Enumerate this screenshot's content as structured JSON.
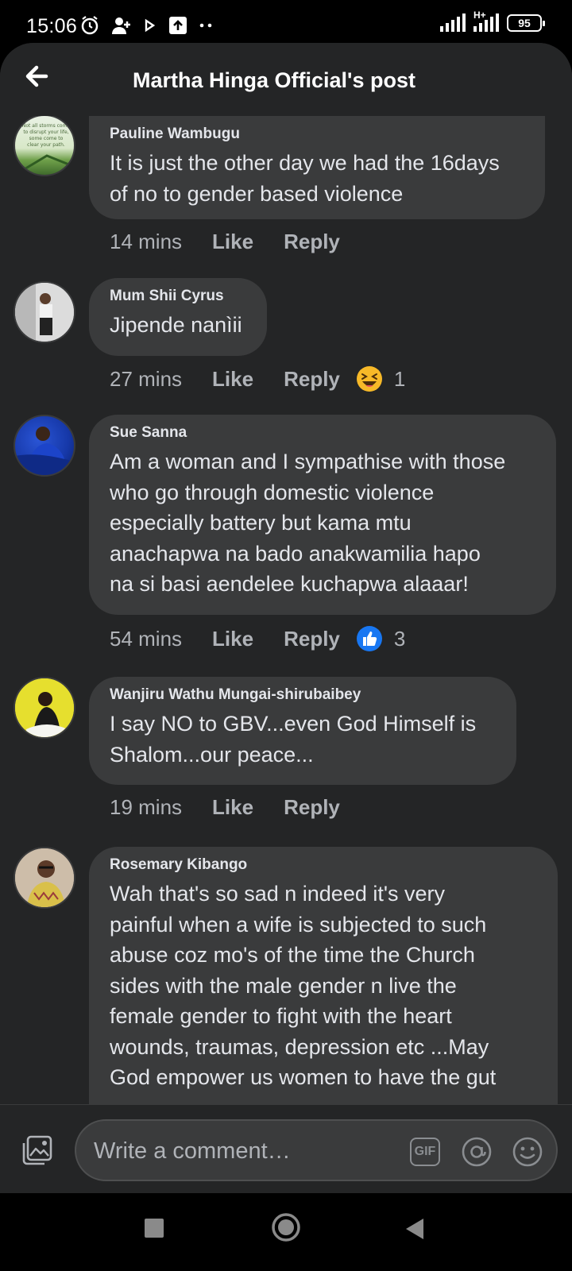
{
  "status_bar": {
    "time": "15:06",
    "network_label": "H+",
    "battery": "95"
  },
  "header": {
    "title": "Martha Hinga Official's post"
  },
  "comments": [
    {
      "author": "Pauline Wambugu",
      "lines": [
        "It is just the other day we had the 16days",
        "of no to gender based violence"
      ],
      "time": "14 mins",
      "like": "Like",
      "reply": "Reply",
      "reaction_count": null
    },
    {
      "author": "Mum Shii Cyrus",
      "lines": [
        "Jipende nanìii"
      ],
      "time": "27 mins",
      "like": "Like",
      "reply": "Reply",
      "reaction_count": "1",
      "reaction": "laughing-emoji"
    },
    {
      "author": "Sue Sanna",
      "lines": [
        "Am a woman and I sympathise with those",
        "who go through domestic violence",
        "especially battery but kama mtu",
        "anachapwa na bado anakwamilia hapo",
        "na si basi aendelee kuchapwa alaaar!"
      ],
      "time": "54 mins",
      "like": "Like",
      "reply": "Reply",
      "reaction_count": "3",
      "reaction": "like-thumb"
    },
    {
      "author": "Wanjiru Wathu Mungai-shirubaibey",
      "lines": [
        "I say NO to GBV...even God Himself is",
        "Shalom...our peace..."
      ],
      "time": "19 mins",
      "like": "Like",
      "reply": "Reply",
      "reaction_count": null
    },
    {
      "author": "Rosemary Kibango",
      "lines": [
        "Wah that's so sad n indeed it's very",
        "painful when a wife is subjected to such",
        "abuse coz mo's of the time the Church",
        "sides with the male gender n live the",
        "female gender to fight with the heart",
        "wounds, traumas, depression etc ...May",
        "God empower us women to have the gut"
      ],
      "time": "",
      "like": "",
      "reply": "",
      "reaction_count": null
    }
  ],
  "composer": {
    "placeholder": "Write a comment…",
    "gif_label": "GIF"
  },
  "avatar_texts": {
    "pauline": [
      "Not all storms come",
      "to disrupt your life,",
      "some come to",
      "clear your path."
    ]
  },
  "colors": {
    "background": "#242526",
    "bubble": "#3a3b3c",
    "text": "#e4e6eb",
    "muted": "#b0b3b8",
    "like_blue": "#1877f2"
  }
}
